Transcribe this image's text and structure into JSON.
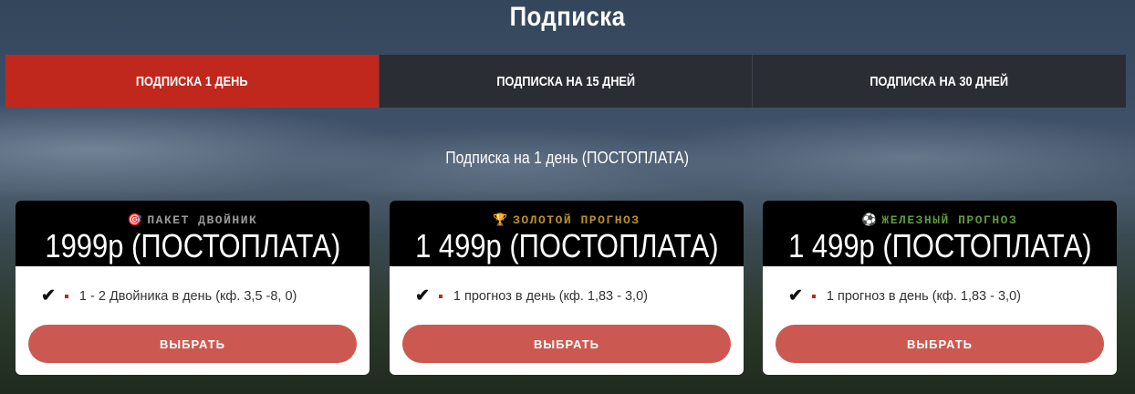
{
  "page_title": "Подписка",
  "tabs": [
    {
      "label": "ПОДПИСКА 1 ДЕНЬ",
      "active": true
    },
    {
      "label": "ПОДПИСКА НА 15 ДНЕЙ",
      "active": false
    },
    {
      "label": "ПОДПИСКА НА 30 ДНЕЙ",
      "active": false
    }
  ],
  "subtitle": "Подписка на 1 день (ПОСТОПЛАТА)",
  "colors": {
    "accent": "#c0281e",
    "button": "#cc5951",
    "tab_bg": "#2a2d34"
  },
  "cards": [
    {
      "badge_icon": "target-icon",
      "badge_glyph": "🎯",
      "badge": "ПАКЕТ ДВОЙНИК",
      "badge_color": "#9a9a9a",
      "price": "1999р (ПОСТОПЛАТА)",
      "feature": "1 - 2 Двойника в день (кф. 3,5 -8, 0)",
      "button": "ВЫБРАТЬ"
    },
    {
      "badge_icon": "trophy-icon",
      "badge_glyph": "🏆",
      "badge": "ЗОЛОТОЙ ПРОГНОЗ",
      "badge_color": "#b8902a",
      "price": "1 499р (ПОСТОПЛАТА)",
      "feature": "1 прогноз в день (кф. 1,83 - 3,0)",
      "button": "ВЫБРАТЬ"
    },
    {
      "badge_icon": "soccer-ball-icon",
      "badge_glyph": "⚽",
      "badge": "ЖЕЛЕЗНЫЙ ПРОГНОЗ",
      "badge_color": "#5f9a3a",
      "price": "1 499р (ПОСТОПЛАТА)",
      "feature": "1 прогноз в день (кф. 1,83 - 3,0)",
      "button": "ВЫБРАТЬ"
    }
  ]
}
